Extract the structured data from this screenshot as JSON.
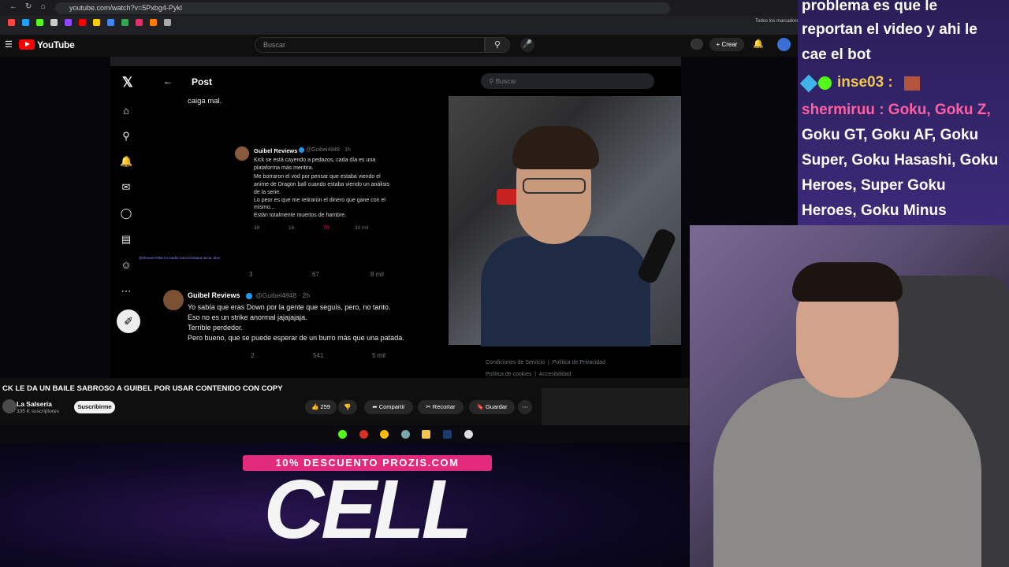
{
  "browser": {
    "url": "youtube.com/watch?v=5Pxbg4-Pykl",
    "bookmarks_label": "Todos los marcadores"
  },
  "youtube": {
    "logo_text": "YouTube",
    "search_placeholder": "Buscar",
    "create_label": "Crear",
    "video_title": "CK LE DA UN BAILE SABROSO A GUIBEL POR USAR CONTENIDO CON COPY",
    "channel_name": "La Salsería",
    "subscribers": "335 K suscriptores",
    "subscribe_label": "Suscribirme",
    "likes": "259",
    "share_label": "Compartir",
    "clip_label": "Recortar",
    "save_label": "Guardar"
  },
  "x_page": {
    "post_title": "Post",
    "search_placeholder": "Buscar",
    "prev_text": "caiga mal.",
    "quote": {
      "user": "Guibel Reviews",
      "handle": "@Guibel4848 · 1h",
      "lines": [
        "Kick se está cayendo a pedazos, cada día es una",
        "plataforma más mentira.",
        "Me borraron el vod por pensar que estaba viendo el",
        "anime de Dragon ball cuando estaba viendo un análisis",
        "de la serie.",
        "Lo peor es que me retiraron el dinero que gane con el",
        "mismo...",
        "Están totalmente muertos de hambre."
      ],
      "stats": [
        "38",
        "16",
        "70",
        "30 mil"
      ]
    },
    "post_stats": [
      "3",
      "67",
      "8 mil"
    ],
    "reply": {
      "user": "Guibel Reviews",
      "handle": "@Guibel4848 · 2h",
      "lines": [
        "Yo sabía que eras Down por la gente que seguís, pero, no tanto.",
        "Eso no es un strike anormal jajajajaja.",
        "Terrible perdedor.",
        "Pero bueno, que se puede esperar de un burro más que una patada."
      ],
      "stats": [
        "2",
        "541",
        "5 mil"
      ]
    },
    "footer_links": [
      "Condiciones de Servicio",
      "Política de Privacidad",
      "Política de cookies",
      "Accesibilidad"
    ]
  },
  "promo": {
    "badge": "10% DESCUENTO PROZIS.COM",
    "title": "CELL"
  },
  "chat": {
    "lines": [
      "problema es que le",
      "reportan el video y ahi le",
      "cae el bot",
      "inse03 :",
      "shermiruu : Goku, Goku Z,",
      "Goku GT, Goku AF, Goku",
      "Super, Goku Hasashi, Goku",
      "Heroes, Super Goku",
      "Heroes, Goku Minus"
    ]
  },
  "colors": {
    "yt_red": "#ff0000",
    "promo_pink": "#e22b7c",
    "chat_bg": "#2a1e58",
    "username_pink": "#ff5fa2",
    "username_yellow": "#f2c94c"
  }
}
